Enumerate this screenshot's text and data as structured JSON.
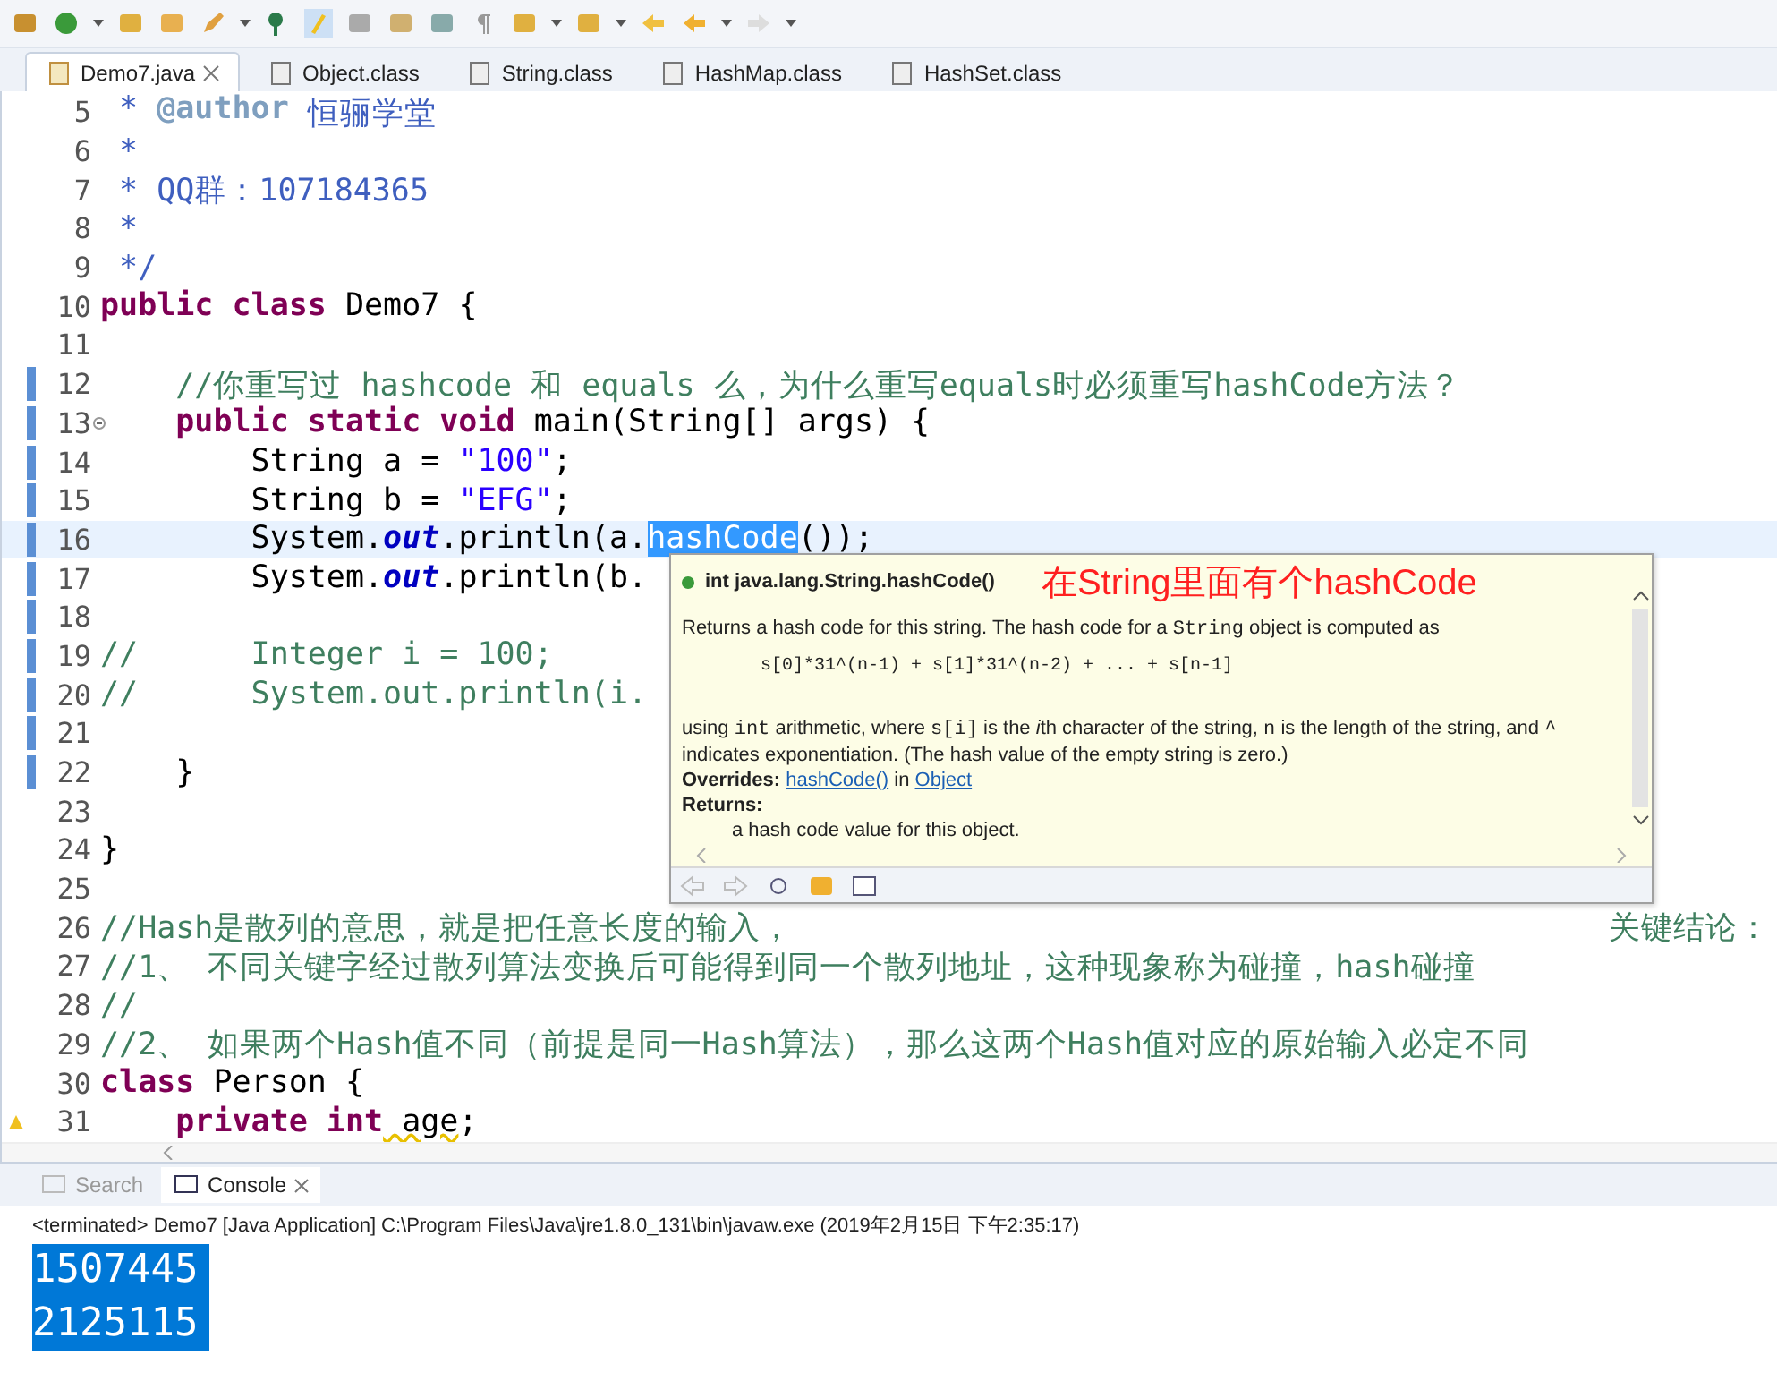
{
  "editor_tabs": [
    {
      "label": "Demo7.java",
      "selected": true,
      "kind": "source"
    },
    {
      "label": "Object.class",
      "selected": false,
      "kind": "class"
    },
    {
      "label": "String.class",
      "selected": false,
      "kind": "class"
    },
    {
      "label": "HashMap.class",
      "selected": false,
      "kind": "class"
    },
    {
      "label": "HashSet.class",
      "selected": false,
      "kind": "class"
    }
  ],
  "code_lines": [
    {
      "number": "5",
      "changed": false,
      "current": false,
      "segments": [
        {
          "kind": "javadoc",
          "text": " * "
        },
        {
          "kind": "tag",
          "text": "@author"
        },
        {
          "kind": "javadoc",
          "text": " 恒骊学堂"
        }
      ]
    },
    {
      "number": "6",
      "changed": false,
      "current": false,
      "segments": [
        {
          "kind": "javadoc",
          "text": " *"
        }
      ]
    },
    {
      "number": "7",
      "changed": false,
      "current": false,
      "segments": [
        {
          "kind": "javadoc",
          "text": " * QQ群：107184365"
        }
      ]
    },
    {
      "number": "8",
      "changed": false,
      "current": false,
      "segments": [
        {
          "kind": "javadoc",
          "text": " *"
        }
      ]
    },
    {
      "number": "9",
      "changed": false,
      "current": false,
      "segments": [
        {
          "kind": "javadoc",
          "text": " */"
        }
      ]
    },
    {
      "number": "10",
      "changed": false,
      "current": false,
      "segments": [
        {
          "kind": "keyword",
          "text": "public class"
        },
        {
          "kind": "plain",
          "text": " Demo7 {"
        }
      ]
    },
    {
      "number": "11",
      "changed": false,
      "current": false
    },
    {
      "number": "12",
      "changed": true,
      "current": false,
      "segments": [
        {
          "kind": "comment",
          "text": "    //你重写过 hashcode 和 equals 么，为什么重写equals时必须重写hashCode方法？"
        }
      ]
    },
    {
      "number": "13",
      "changed": true,
      "current": false,
      "kind": "fold",
      "segments": [
        {
          "kind": "keyword",
          "text": "    public static void"
        },
        {
          "kind": "plain",
          "text": " main(String[] args) {"
        }
      ]
    },
    {
      "number": "14",
      "changed": true,
      "current": false,
      "segments": [
        {
          "kind": "plain",
          "text": "        String a = "
        },
        {
          "kind": "string",
          "text": "\"100\""
        },
        {
          "kind": "plain",
          "text": ";"
        }
      ]
    },
    {
      "number": "15",
      "changed": true,
      "current": false,
      "segments": [
        {
          "kind": "plain",
          "text": "        String b = "
        },
        {
          "kind": "string",
          "text": "\"EFG\""
        },
        {
          "kind": "plain",
          "text": ";"
        }
      ]
    },
    {
      "number": "16",
      "changed": true,
      "current": true,
      "segments": [
        {
          "kind": "plain",
          "text": "        System."
        },
        {
          "kind": "field",
          "text": "out"
        },
        {
          "kind": "plain",
          "text": ".println(a."
        },
        {
          "kind": "selected",
          "text": "hashCode"
        },
        {
          "kind": "plain",
          "text": "());"
        }
      ]
    },
    {
      "number": "17",
      "changed": true,
      "current": false,
      "segments": [
        {
          "kind": "plain",
          "text": "        System."
        },
        {
          "kind": "field",
          "text": "out"
        },
        {
          "kind": "plain",
          "text": ".println(b."
        }
      ]
    },
    {
      "number": "18",
      "changed": true,
      "current": false
    },
    {
      "number": "19",
      "changed": true,
      "current": false,
      "segments": [
        {
          "kind": "comment",
          "text": "//      Integer i = 100;"
        }
      ]
    },
    {
      "number": "20",
      "changed": true,
      "current": false,
      "segments": [
        {
          "kind": "comment",
          "text": "//      System.out.println(i."
        }
      ]
    },
    {
      "number": "21",
      "changed": true,
      "current": false
    },
    {
      "number": "22",
      "changed": true,
      "current": false,
      "segments": [
        {
          "kind": "plain",
          "text": "    }"
        }
      ]
    },
    {
      "number": "23",
      "changed": false,
      "current": false
    },
    {
      "number": "24",
      "changed": false,
      "current": false,
      "segments": [
        {
          "kind": "plain",
          "text": "}"
        }
      ]
    },
    {
      "number": "25",
      "changed": false,
      "current": false
    },
    {
      "number": "26",
      "changed": false,
      "current": false,
      "segments": [
        {
          "kind": "comment",
          "text": "//Hash是散列的意思，就是把任意长度的输入，"
        },
        {
          "kind": "comment-right",
          "text": "关键结论："
        }
      ]
    },
    {
      "number": "27",
      "changed": false,
      "current": false,
      "segments": [
        {
          "kind": "comment",
          "text": "//1、 不同关键字经过散列算法变换后可能得到同一个散列地址，这种现象称为碰撞，hash碰撞"
        }
      ]
    },
    {
      "number": "28",
      "changed": false,
      "current": false,
      "segments": [
        {
          "kind": "comment",
          "text": "//"
        }
      ]
    },
    {
      "number": "29",
      "changed": false,
      "current": false,
      "segments": [
        {
          "kind": "comment",
          "text": "//2、 如果两个Hash值不同（前提是同一Hash算法），那么这两个Hash值对应的原始输入必定不同"
        }
      ]
    },
    {
      "number": "30",
      "changed": false,
      "current": false,
      "segments": [
        {
          "kind": "keyword",
          "text": "class"
        },
        {
          "kind": "plain",
          "text": " Person {"
        }
      ]
    },
    {
      "number": "31",
      "changed": false,
      "current": false,
      "kind": "warning",
      "segments": [
        {
          "kind": "keyword",
          "text": "    private int"
        },
        {
          "kind": "warn",
          "text": " age"
        },
        {
          "kind": "plain",
          "text": ";"
        }
      ]
    }
  ],
  "hover_popup": {
    "signature": "int java.lang.String.hashCode()",
    "annotation": "在String里面有个hashCode",
    "paragraphs": [
      [
        {
          "kind": "text",
          "text": "Returns a hash code for this string. The hash code for a "
        },
        {
          "kind": "code",
          "text": "String"
        },
        {
          "kind": "text",
          "text": " object is computed as"
        }
      ],
      [
        {
          "kind": "formula",
          "text": "s[0]*31^(n-1) + s[1]*31^(n-2) + ... + s[n-1]"
        }
      ],
      [
        {
          "kind": "text",
          "text": "using "
        },
        {
          "kind": "code",
          "text": "int"
        },
        {
          "kind": "text",
          "text": " arithmetic, where "
        },
        {
          "kind": "code",
          "text": "s[i]"
        },
        {
          "kind": "text",
          "text": " is the "
        },
        {
          "kind": "italic",
          "text": "i"
        },
        {
          "kind": "text",
          "text": "th character of the string, "
        },
        {
          "kind": "code",
          "text": "n"
        },
        {
          "kind": "text",
          "text": " is the length of the string, and "
        },
        {
          "kind": "code",
          "text": "^"
        },
        {
          "kind": "text",
          "text": " indicates exponentiation. (The hash value of the empty string is zero.)"
        }
      ]
    ],
    "overrides": {
      "label": "Overrides:",
      "method": "hashCode()",
      "in": "in",
      "class": "Object"
    },
    "returns": {
      "label": "Returns:",
      "text": "a hash code value for this object."
    }
  },
  "bottom_tabs": [
    {
      "label": "Search",
      "selected": false
    },
    {
      "label": "Console",
      "selected": true
    }
  ],
  "console": {
    "header": "<terminated> Demo7 [Java Application] C:\\Program Files\\Java\\jre1.8.0_131\\bin\\javaw.exe (2019年2月15日 下午2:35:17)",
    "output": [
      {
        "text": "1507445",
        "selected": true
      },
      {
        "text": "2125115",
        "selected": true
      }
    ]
  }
}
